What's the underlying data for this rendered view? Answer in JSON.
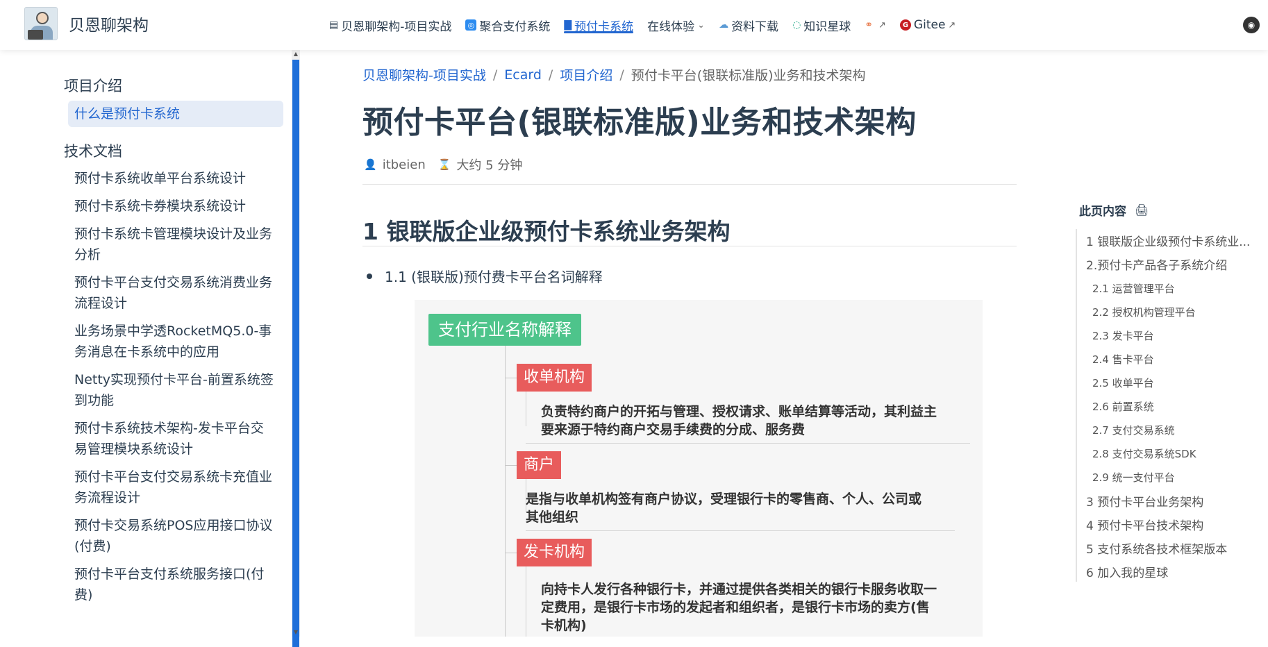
{
  "brand": {
    "title": "贝恩聊架构"
  },
  "nav": [
    {
      "label": "贝恩聊架构-项目实战",
      "icon": "document-icon",
      "active": false,
      "dropdown": false,
      "external": false
    },
    {
      "label": "聚合支付系统",
      "icon": "payment-card-icon",
      "active": false,
      "dropdown": false,
      "external": false
    },
    {
      "label": "预付卡系统",
      "icon": "book-icon",
      "active": true,
      "dropdown": false,
      "external": false
    },
    {
      "label": "在线体验",
      "icon": "",
      "active": false,
      "dropdown": true,
      "external": false
    },
    {
      "label": "资料下载",
      "icon": "cloud-icon",
      "active": false,
      "dropdown": false,
      "external": false
    },
    {
      "label": "知识星球",
      "icon": "circle-icon",
      "active": false,
      "dropdown": false,
      "external": false
    },
    {
      "label": "",
      "icon": "link-icon",
      "active": false,
      "dropdown": false,
      "external": true
    },
    {
      "label": "Gitee",
      "icon": "gitee-icon",
      "active": false,
      "dropdown": false,
      "external": true
    }
  ],
  "sidebar": {
    "groups": [
      {
        "title": "项目介绍",
        "items": [
          "什么是预付卡系统"
        ]
      },
      {
        "title": "技术文档",
        "items": [
          "预付卡系统收单平台系统设计",
          "预付卡系统卡券模块系统设计",
          "预付卡系统卡管理模块设计及业务分析",
          "预付卡平台支付交易系统消费业务流程设计",
          "业务场景中学透RocketMQ5.0-事务消息在卡系统中的应用",
          "Netty实现预付卡平台-前置系统签到功能",
          "预付卡系统技术架构-发卡平台交易管理模块系统设计",
          "预付卡平台支付交易系统卡充值业务流程设计",
          "预付卡交易系统POS应用接口协议(付费)",
          "预付卡平台支付系统服务接口(付费)"
        ]
      }
    ],
    "active_item": "什么是预付卡系统"
  },
  "breadcrumb": [
    {
      "label": "贝恩聊架构-项目实战",
      "link": true
    },
    {
      "label": "Ecard",
      "link": true
    },
    {
      "label": "项目介绍",
      "link": true
    },
    {
      "label": "预付卡平台(银联标准版)业务和技术架构",
      "link": false
    }
  ],
  "article": {
    "title": "预付卡平台(银联标准版)业务和技术架构",
    "author": "itbeien",
    "read_time": "大约 5 分钟",
    "h2": "1 银联版企业级预付卡系统业务架构",
    "bullet": "1.1 (银联版)预付费卡平台名词解释"
  },
  "mindmap": {
    "root": "支付行业名称解释",
    "nodes": [
      {
        "label": "收单机构",
        "desc": [
          "负责特约商户的开拓与管理、授权请求、账单结算等活动，其利益主",
          "要来源于特约商户交易手续费的分成、服务费"
        ]
      },
      {
        "label": "商户",
        "desc": [
          "是指与收单机构签有商户协议，受理银行卡的零售商、个人、公司或",
          "其他组织"
        ]
      },
      {
        "label": "发卡机构",
        "desc": [
          "向持卡人发行各种银行卡，并通过提供各类相关的银行卡服务收取一",
          "定费用，是银行卡市场的发起者和组织者，是银行卡市场的卖方(售",
          "卡机构)"
        ]
      }
    ]
  },
  "toc": {
    "title": "此页内容",
    "items": [
      {
        "label": "1 银联版企业级预付卡系统业...",
        "level": 1
      },
      {
        "label": "2.预付卡产品各子系统介绍",
        "level": 1
      },
      {
        "label": "2.1 运营管理平台",
        "level": 2
      },
      {
        "label": "2.2 授权机构管理平台",
        "level": 2
      },
      {
        "label": "2.3 发卡平台",
        "level": 2
      },
      {
        "label": "2.4 售卡平台",
        "level": 2
      },
      {
        "label": "2.5 收单平台",
        "level": 2
      },
      {
        "label": "2.6 前置系统",
        "level": 2
      },
      {
        "label": "2.7 支付交易系统",
        "level": 2
      },
      {
        "label": "2.8 支付交易系统SDK",
        "level": 2
      },
      {
        "label": "2.9 统一支付平台",
        "level": 2
      },
      {
        "label": "3 预付卡平台业务架构",
        "level": 1
      },
      {
        "label": "4 预付卡平台技术架构",
        "level": 1
      },
      {
        "label": "5 支付系统各技术框架版本",
        "level": 1
      },
      {
        "label": "6 加入我的星球",
        "level": 1
      }
    ]
  },
  "colors": {
    "accent": "#2266d0",
    "root_node": "#4ec48b",
    "child_node": "#e85c5c"
  }
}
